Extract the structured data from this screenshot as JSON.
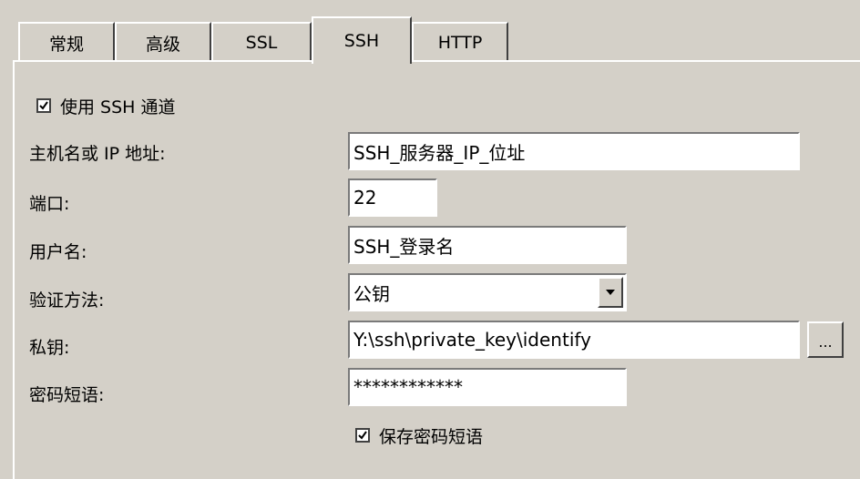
{
  "tabs": [
    {
      "label": "常规"
    },
    {
      "label": "高级"
    },
    {
      "label": "SSL"
    },
    {
      "label": "SSH"
    },
    {
      "label": "HTTP"
    }
  ],
  "use_ssh": {
    "label": "使用 SSH 通道",
    "checked": true
  },
  "host": {
    "label": "主机名或 IP 地址:",
    "value": "SSH_服务器_IP_位址"
  },
  "port": {
    "label": "端口:",
    "value": "22"
  },
  "username": {
    "label": "用户名:",
    "value": "SSH_登录名"
  },
  "auth": {
    "label": "验证方法:",
    "value": "公钥"
  },
  "private_key": {
    "label": "私钥:",
    "value": "Y:\\ssh\\private_key\\identify",
    "browse_label": "..."
  },
  "passphrase": {
    "label": "密码短语:",
    "value": "************"
  },
  "save_passphrase": {
    "label": "保存密码短语",
    "checked": true
  }
}
